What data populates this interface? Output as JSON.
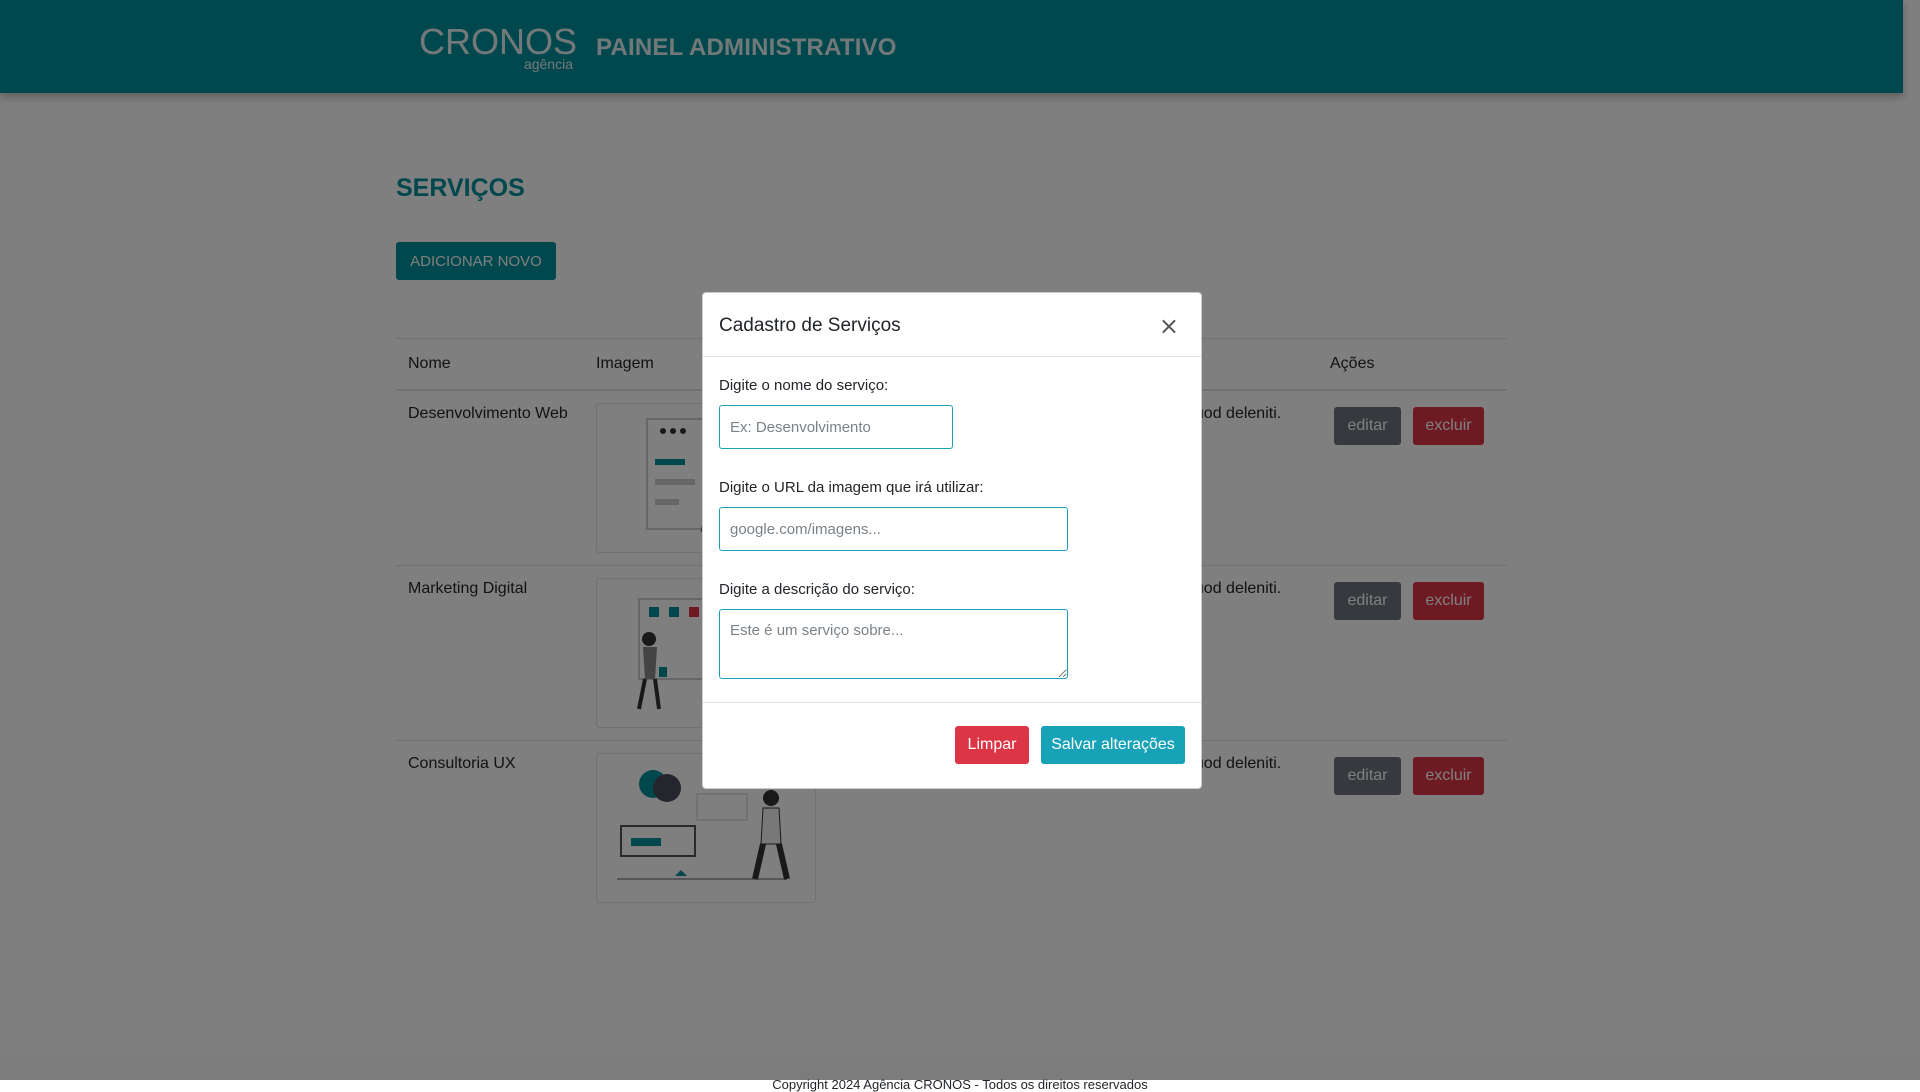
{
  "header": {
    "logo_main": "CRONOS",
    "logo_sub": "agência",
    "title": "PAINEL ADMINISTRATIVO"
  },
  "main": {
    "page_title": "SERVIÇOS",
    "add_button": "ADICIONAR NOVO",
    "table": {
      "headers": [
        "Nome",
        "Imagem",
        "Ações"
      ],
      "rows": [
        {
          "name": "Desenvolvimento Web",
          "desc_visible": "quod deleniti.",
          "edit": "editar",
          "delete": "excluir"
        },
        {
          "name": "Marketing Digital",
          "desc_visible": "quod deleniti.",
          "edit": "editar",
          "delete": "excluir"
        },
        {
          "name": "Consultoria UX",
          "desc_visible": "quod deleniti.",
          "edit": "editar",
          "delete": "excluir"
        }
      ]
    }
  },
  "footer": {
    "text": "Copyright 2024 Agência CRONOS - Todos os direitos reservados"
  },
  "modal": {
    "title": "Cadastro de Serviços",
    "close": "×",
    "fields": [
      {
        "label": "Digite o nome do serviço:",
        "placeholder": "Ex: Desenvolvimento"
      },
      {
        "label": "Digite o URL da imagem que irá utilizar:",
        "placeholder": "google.com/imagens..."
      },
      {
        "label": "Digite a descrição do serviço:",
        "placeholder": "Este é um serviço sobre..."
      }
    ],
    "clear_button": "Limpar",
    "save_button": "Salvar alterações"
  },
  "colors": {
    "brand": "#00909a",
    "danger": "#dc3545",
    "info": "#17a2b8",
    "secondary": "#6c757d"
  }
}
